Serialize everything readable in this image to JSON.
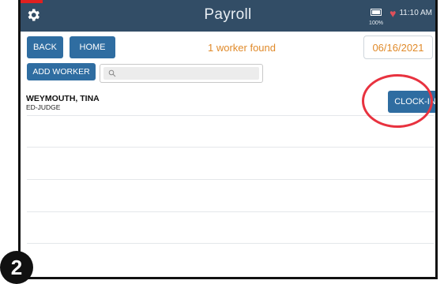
{
  "header": {
    "title": "Payroll",
    "battery_percent": "100%",
    "time": "11:10 AM",
    "gear_icon": "gear-icon",
    "battery_icon": "battery-icon",
    "heart_icon": "heart-icon",
    "accent_color": "#324d66",
    "tag_color": "#e02020"
  },
  "toolbar": {
    "back_label": "BACK",
    "home_label": "HOME",
    "found_text": "1 worker found",
    "date": "06/16/2021",
    "add_worker_label": "ADD WORKER",
    "search_placeholder": "",
    "search_value": ""
  },
  "workers": [
    {
      "name": "WEYMOUTH, TINA",
      "role": "ED-JUDGE",
      "action_label": "CLOCK-IN"
    }
  ],
  "annotation": {
    "step_number": "2",
    "highlight_color": "#e8323f"
  },
  "colors": {
    "button_blue": "#2f6da1",
    "orange_text": "#e08a2a"
  }
}
